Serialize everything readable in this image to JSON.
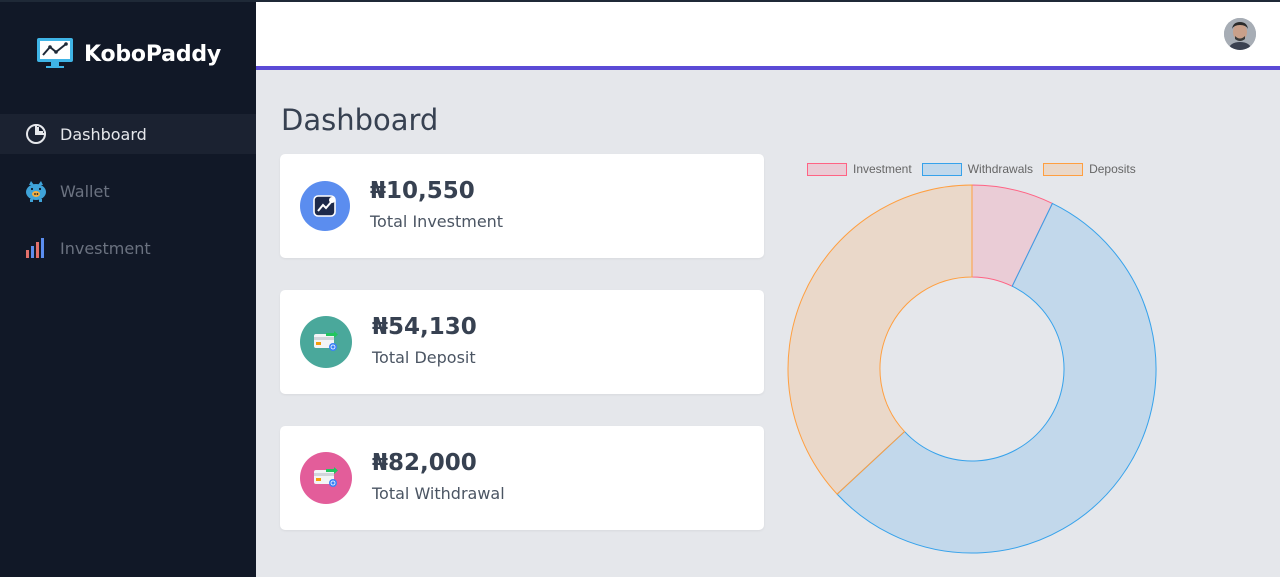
{
  "app": {
    "name": "KoboPaddy"
  },
  "sidebar": {
    "items": [
      {
        "label": "Dashboard",
        "icon": "pie-chart-icon",
        "active": true
      },
      {
        "label": "Wallet",
        "icon": "piggy-bank-icon",
        "active": false
      },
      {
        "label": "Investment",
        "icon": "bar-chart-icon",
        "active": false
      }
    ]
  },
  "header": {
    "avatar": "user-avatar"
  },
  "main": {
    "title": "Dashboard",
    "cards": [
      {
        "value": "₦10,550",
        "label": "Total Investment",
        "icon": "investment-chart-icon",
        "color": "#5b8def"
      },
      {
        "value": "₦54,130",
        "label": "Total Deposit",
        "icon": "credit-card-icon",
        "color": "#4aa89b"
      },
      {
        "value": "₦82,000",
        "label": "Total Withdrawal",
        "icon": "credit-card-icon",
        "color": "#e35d9a"
      }
    ]
  },
  "colors": {
    "sidebar_bg": "#111827",
    "accent": "#5b4ad6",
    "page_bg": "#e5e7eb"
  },
  "chart_data": {
    "type": "doughnut",
    "categories": [
      "Investment",
      "Withdrawals",
      "Deposits"
    ],
    "values": [
      10550,
      82000,
      54130
    ],
    "colors": {
      "fill": [
        "rgba(255,99,132,0.2)",
        "rgba(54,162,235,0.2)",
        "rgba(255,159,64,0.2)"
      ],
      "border": [
        "rgb(255,99,132)",
        "rgb(54,162,235)",
        "rgb(255,159,64)"
      ]
    },
    "legend": "top"
  }
}
